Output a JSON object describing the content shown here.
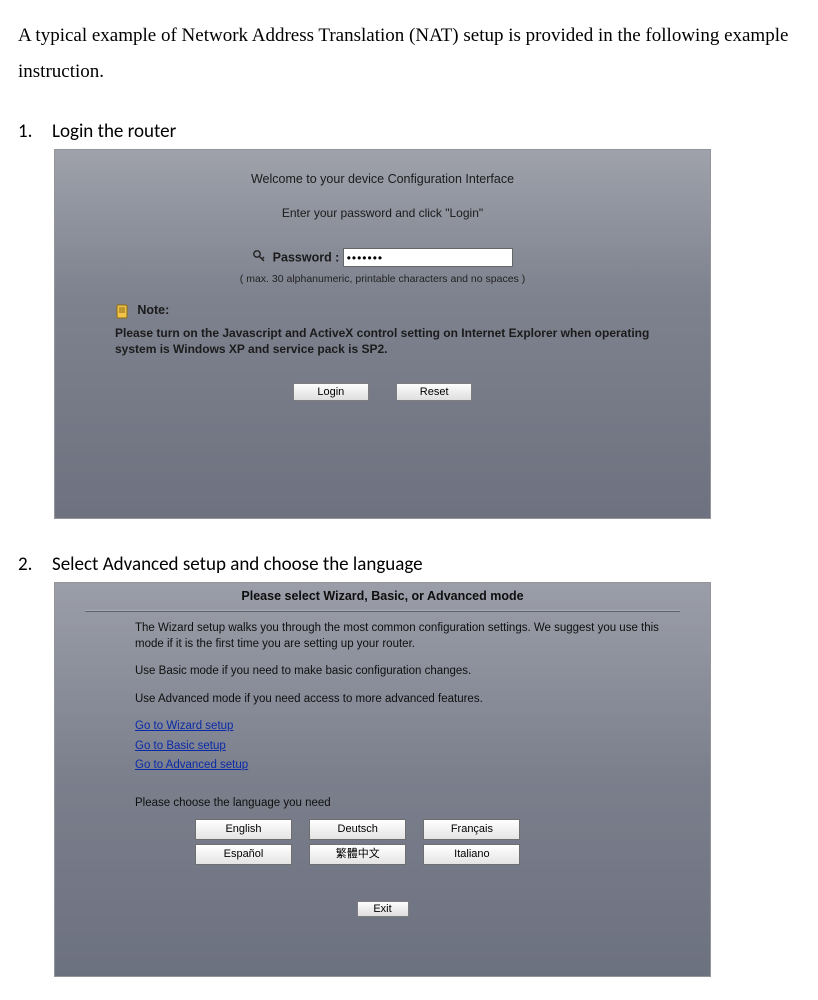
{
  "intro": "A typical example of Network Address Translation (NAT) setup is provided in the following example instruction.",
  "steps": {
    "s1_num": "1.",
    "s1_text": "Login the router",
    "s2_num": "2.",
    "s2_text": "Select Advanced setup and choose the language"
  },
  "login": {
    "welcome": "Welcome to your device Configuration Interface",
    "enter": "Enter your password and click \"Login\"",
    "password_label": "Password :",
    "password_value": "•••••••",
    "hint": "( max. 30 alphanumeric, printable characters and no spaces )",
    "note_title": "Note:",
    "note_body": "Please turn on the Javascript and ActiveX control setting on Internet Explorer when operating system is Windows XP and service pack is SP2.",
    "login_btn": "Login",
    "reset_btn": "Reset"
  },
  "mode": {
    "header": "Please select Wizard, Basic, or Advanced mode",
    "para1": "The Wizard setup walks you through the most common configuration settings. We suggest you use this mode if it is the first time you are setting up your router.",
    "para2": "Use Basic mode if you need to make basic configuration changes.",
    "para3": "Use Advanced mode if you need access to more advanced features.",
    "link_wizard": "Go to Wizard setup",
    "link_basic": "Go to Basic setup",
    "link_advanced": "Go to Advanced setup",
    "lang_label": "Please choose the language you need",
    "lang": {
      "en": "English",
      "de": "Deutsch",
      "fr": "Français",
      "es": "Español",
      "zh": "繁體中文",
      "it": "Italiano"
    },
    "exit": "Exit"
  }
}
